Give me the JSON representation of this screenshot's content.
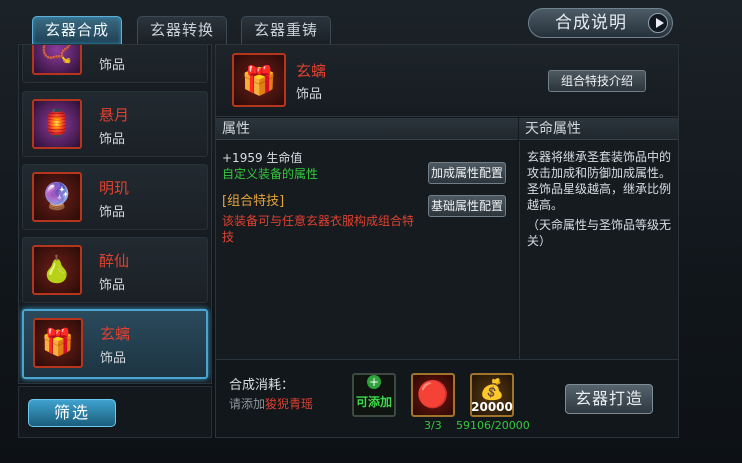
{
  "tabs": [
    {
      "label": "玄器合成",
      "active": true
    },
    {
      "label": "玄器转换",
      "active": false
    },
    {
      "label": "玄器重铸",
      "active": false
    }
  ],
  "help_button": {
    "label": "合成说明"
  },
  "list": {
    "items": [
      {
        "name": "",
        "type": "饰品",
        "icon": "ornament-pendant-icon",
        "frame": "purple"
      },
      {
        "name": "悬月",
        "type": "饰品",
        "icon": "lantern-icon",
        "frame": "purple"
      },
      {
        "name": "明玑",
        "type": "饰品",
        "icon": "jade-icon",
        "frame": "red"
      },
      {
        "name": "醉仙",
        "type": "饰品",
        "icon": "gourd-icon",
        "frame": "red"
      },
      {
        "name": "玄螭",
        "type": "饰品",
        "icon": "treasure-chest-icon",
        "frame": "red",
        "selected": true
      }
    ],
    "filter_label": "筛选"
  },
  "detail": {
    "name": "玄螭",
    "type": "饰品",
    "combo_intro_label": "组合特技介绍",
    "attr_header": "属性",
    "tianming_header": "天命属性",
    "hp_line": "+1959 生命值",
    "custom_attr": "自定义装备的属性",
    "bonus_config_label": "加成属性配置",
    "combo_title": "[组合特技]",
    "combo_desc": "该装备可与任意玄器衣服构成组合特技",
    "base_config_label": "基础属性配置",
    "tianming_text": "玄器将继承圣套装饰品中的攻击加成和防御加成属性。圣饰品星级越高，继承比例越高。",
    "tianming_note": "（天命属性与圣饰品等级无关）"
  },
  "cost": {
    "label": "合成消耗：",
    "hint_prefix": "请添加",
    "hint_item": "狻猊青瑶",
    "add_slot_label": "可添加",
    "material_count": "3/3",
    "gold_value": "20000",
    "gold_count": "59106/20000",
    "forge_label": "玄器打造"
  },
  "colors": {
    "accent_blue": "#4aa6d0",
    "item_name_red": "#e0412f",
    "green": "#34c83e",
    "orange": "#e6a33a"
  }
}
